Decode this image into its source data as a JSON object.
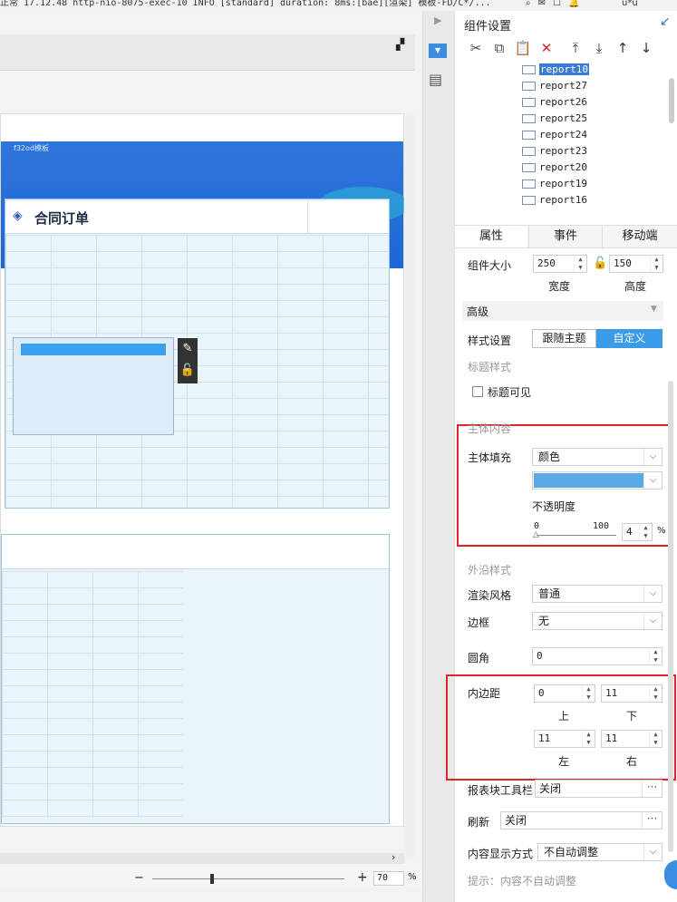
{
  "top_strip": "正常 17.12.48 http-nio-8075-exec-10 INFO [standard] duration: 8ms:[bae][渲染] 模板-FD/C*/...",
  "top_right": "u*u",
  "designer": {
    "banner_note": "f32od模板",
    "report_title": "合同订单",
    "zoom_value": "70",
    "zoom_unit": "%"
  },
  "panel": {
    "title": "组件设置",
    "tree_items": [
      "report10",
      "report27",
      "report26",
      "report25",
      "report24",
      "report23",
      "report20",
      "report19",
      "report16"
    ],
    "tabs": [
      "属性",
      "事件",
      "移动端"
    ],
    "size": {
      "label": "组件大小",
      "width": "250",
      "height": "150",
      "width_label": "宽度",
      "height_label": "高度"
    },
    "advanced": "高级",
    "style": {
      "label": "样式设置",
      "follow": "跟随主题",
      "custom": "自定义"
    },
    "title_style": {
      "section": "标题样式",
      "visible": "标题可见"
    },
    "main_content": {
      "section": "主体内容",
      "fill_label": "主体填充",
      "fill_value": "颜色",
      "fill_color": "#5aaae8",
      "opacity_label": "不透明度",
      "slider_min": "0",
      "slider_max": "100",
      "opacity_value": "4",
      "unit": "%"
    },
    "outer": {
      "section": "外沿样式",
      "render_label": "渲染风格",
      "render_value": "普通",
      "border_label": "边框",
      "border_value": "无",
      "radius_label": "圆角",
      "radius_value": "0"
    },
    "padding": {
      "label": "内边距",
      "top": "0",
      "bottom": "11",
      "left": "11",
      "right": "11",
      "top_label": "上",
      "bottom_label": "下",
      "left_label": "左",
      "right_label": "右"
    },
    "toolbar": {
      "label": "报表块工具栏",
      "value": "关闭"
    },
    "refresh": {
      "label": "刷新",
      "value": "关闭"
    },
    "display": {
      "label": "内容显示方式",
      "value": "不自动调整"
    },
    "hint": "提示：内容不自动调整"
  }
}
